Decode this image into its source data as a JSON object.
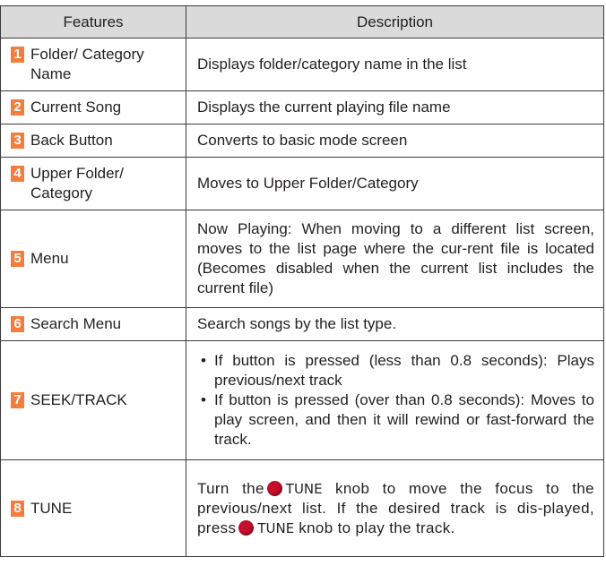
{
  "table": {
    "header": {
      "features": "Features",
      "description": "Description"
    },
    "rows": [
      {
        "num": "1",
        "feature": "Folder/ Category Name",
        "description": "Displays folder/category name in the list"
      },
      {
        "num": "2",
        "feature": "Current Song",
        "description": "Displays the current playing file name"
      },
      {
        "num": "3",
        "feature": "Back Button",
        "description": "Converts to basic mode screen"
      },
      {
        "num": "4",
        "feature": "Upper Folder/ Category",
        "description": "Moves to Upper Folder/Category"
      },
      {
        "num": "5",
        "feature": "Menu",
        "description": "Now Playing: When moving to a different list screen, moves to the list page where the cur-rent file is located (Becomes disabled when the current list includes the current file)"
      },
      {
        "num": "6",
        "feature": "Search Menu",
        "description": "Search songs by the list type."
      },
      {
        "num": "7",
        "feature": "SEEK/TRACK",
        "bullets": [
          "If button is pressed (less than 0.8 seconds): Plays previous/next track",
          "If button is pressed (over than 0.8 seconds): Moves to play screen, and then it will rewind or fast-forward the track."
        ]
      },
      {
        "num": "8",
        "feature": "TUNE",
        "description": {
          "part1": "Turn the",
          "knob1": "TUNE",
          "part2": "knob to move the focus to the previous/next list. If the desired track is dis-played, press",
          "knob2": "TUNE",
          "part3": "knob to play the track."
        }
      }
    ],
    "colors": {
      "number_badge": "#f47c3c",
      "header_bg": "#dadada",
      "knob": "#c8102e",
      "border": "#3a3a3a"
    },
    "icons": {
      "knob": "tune-knob-icon"
    }
  }
}
